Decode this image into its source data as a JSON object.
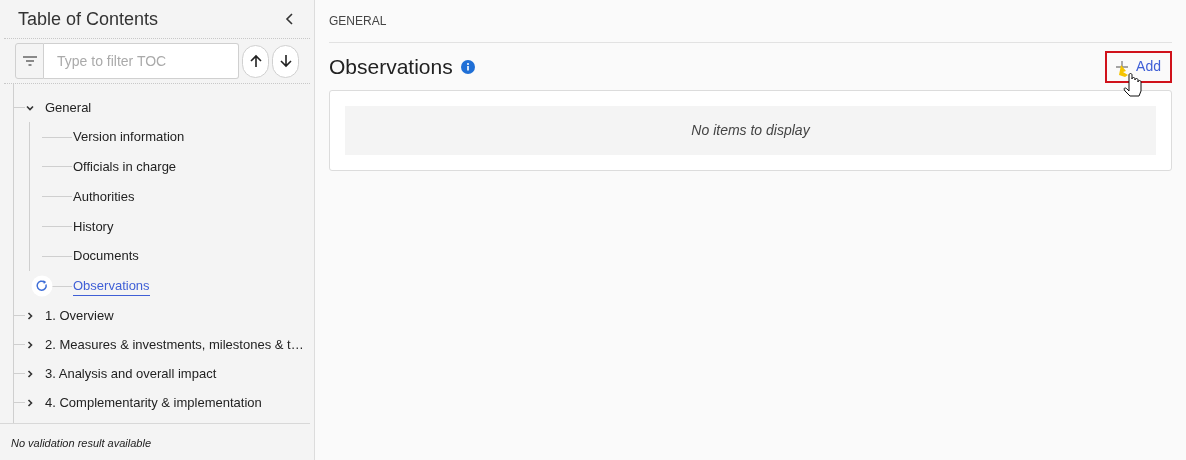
{
  "sidebar": {
    "title": "Table of Contents",
    "filter": {
      "placeholder": "Type to filter TOC"
    },
    "tree": [
      {
        "label": "General",
        "expanded": true,
        "selected": false,
        "children": [
          {
            "label": "Version information",
            "selected": false
          },
          {
            "label": "Officials in charge",
            "selected": false
          },
          {
            "label": "Authorities",
            "selected": false
          },
          {
            "label": "History",
            "selected": false
          },
          {
            "label": "Documents",
            "selected": false
          },
          {
            "label": "Observations",
            "selected": true
          }
        ]
      },
      {
        "label": "1. Overview",
        "expanded": false,
        "selected": false
      },
      {
        "label": "2. Measures & investments, milestones & t…",
        "expanded": false,
        "selected": false
      },
      {
        "label": "3. Analysis and overall impact",
        "expanded": false,
        "selected": false
      },
      {
        "label": "4. Complementarity & implementation",
        "expanded": false,
        "selected": false
      }
    ],
    "status": "No validation result available"
  },
  "main": {
    "breadcrumb": "GENERAL",
    "title": "Observations",
    "add_button": {
      "label": "Add",
      "highlighted": true
    },
    "empty_message": "No items to display"
  }
}
